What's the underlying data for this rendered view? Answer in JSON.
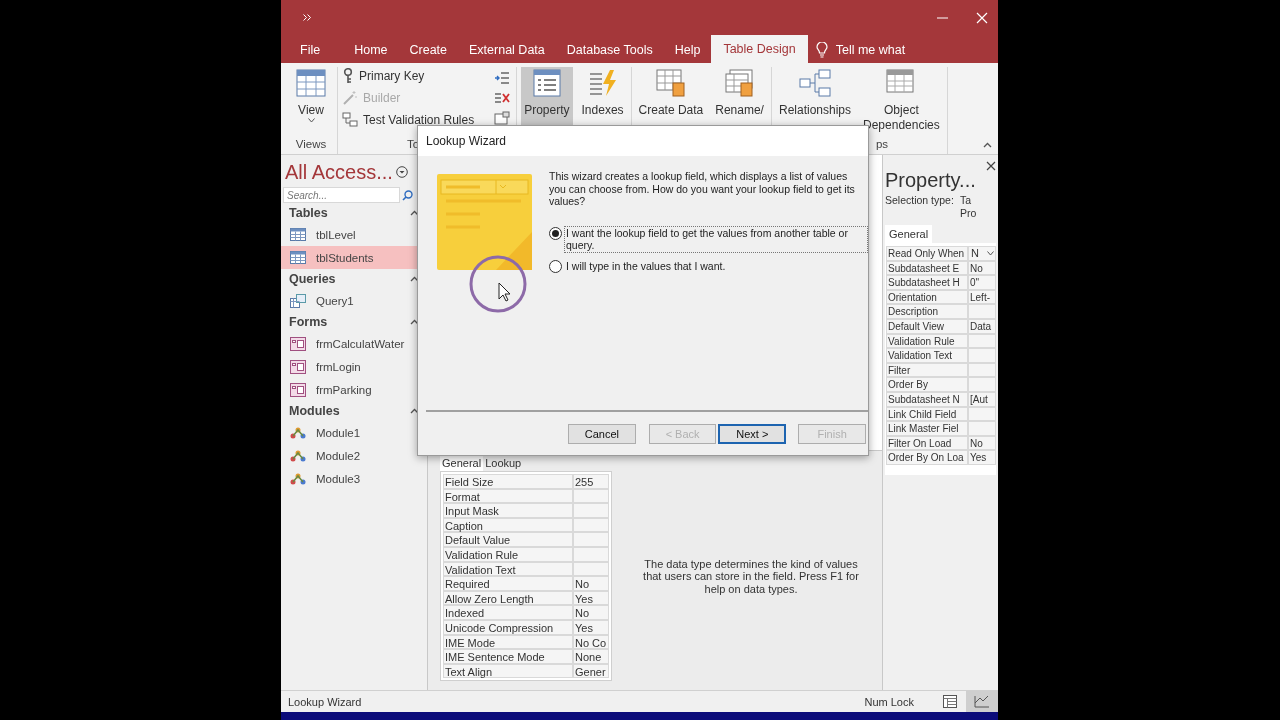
{
  "tabs": [
    {
      "label": "File",
      "selected": false
    },
    {
      "label": "Home",
      "selected": false
    },
    {
      "label": "Create",
      "selected": false
    },
    {
      "label": "External Data",
      "selected": false
    },
    {
      "label": "Database Tools",
      "selected": false
    },
    {
      "label": "Help",
      "selected": false
    },
    {
      "label": "Table Design",
      "selected": true
    }
  ],
  "tell_me": "Tell me what",
  "ribbon": [
    {
      "label": "Views",
      "items": [
        {
          "kind": "large",
          "lines": [
            "View"
          ],
          "dropdown": true,
          "pressed": false
        }
      ]
    },
    {
      "label": "To",
      "items": [
        {
          "kind": "small",
          "label": "Primary Key",
          "disabled": false
        },
        {
          "kind": "small",
          "label": "Builder",
          "disabled": true
        },
        {
          "kind": "small",
          "label": "Test Validation Rules",
          "disabled": false
        },
        {
          "kind": "icons"
        }
      ]
    },
    {
      "items": [
        {
          "kind": "large",
          "lines": [
            "Property"
          ],
          "dropdown": false,
          "pressed": true
        },
        {
          "kind": "large",
          "lines": [
            "Indexes"
          ],
          "dropdown": false,
          "pressed": false
        }
      ]
    },
    {
      "items": [
        {
          "kind": "large",
          "lines": [
            "Create Data"
          ],
          "dropdown": false,
          "pressed": false
        },
        {
          "kind": "large",
          "lines": [
            "Rename/"
          ],
          "dropdown": false,
          "pressed": false
        }
      ]
    },
    {
      "label": "ps",
      "items": [
        {
          "kind": "large",
          "lines": [
            "Relationships"
          ],
          "dropdown": false,
          "pressed": false
        },
        {
          "kind": "large",
          "lines": [
            "Object",
            "Dependencies"
          ],
          "dropdown": false,
          "pressed": false
        }
      ]
    }
  ],
  "nav": {
    "title": "All Access...",
    "search_placeholder": "Search...",
    "groups": [
      {
        "label": "Tables",
        "kind": "table",
        "expanded": true,
        "items": [
          {
            "label": "tblLevel",
            "selected": false
          },
          {
            "label": "tblStudents",
            "selected": true
          }
        ]
      },
      {
        "label": "Queries",
        "kind": "query",
        "expanded": true,
        "items": [
          {
            "label": "Query1",
            "selected": false
          }
        ]
      },
      {
        "label": "Forms",
        "kind": "form",
        "expanded": true,
        "items": [
          {
            "label": "frmCalculatWater",
            "selected": false
          },
          {
            "label": "frmLogin",
            "selected": false
          },
          {
            "label": "frmParking",
            "selected": false
          }
        ]
      },
      {
        "label": "Modules",
        "kind": "module",
        "expanded": true,
        "items": [
          {
            "label": "Module1",
            "selected": false
          },
          {
            "label": "Module2",
            "selected": false
          },
          {
            "label": "Module3",
            "selected": false
          }
        ]
      }
    ]
  },
  "dialog": {
    "title": "Lookup Wizard",
    "intro": "This wizard creates a lookup field, which displays a list of values you can choose from.  How do you want your lookup field to get its values?",
    "options": [
      {
        "label": "I want the lookup field to get the values from another table or query.",
        "selected": true
      },
      {
        "label": "I will type in the values that I want.",
        "selected": false
      }
    ],
    "buttons": [
      {
        "label": "Cancel",
        "disabled": false,
        "default": false
      },
      {
        "label": "< Back",
        "disabled": true,
        "default": false
      },
      {
        "label": "Next >",
        "disabled": false,
        "default": true
      },
      {
        "label": "Finish",
        "disabled": true,
        "default": false
      }
    ]
  },
  "field_properties": {
    "tabs": [
      {
        "label": "General",
        "selected": true
      },
      {
        "label": "Lookup",
        "selected": false
      }
    ],
    "rows": [
      {
        "name": "Field Size",
        "value": "255"
      },
      {
        "name": "Format"
      },
      {
        "name": "Input Mask"
      },
      {
        "name": "Caption"
      },
      {
        "name": "Default Value"
      },
      {
        "name": "Validation Rule"
      },
      {
        "name": "Validation Text"
      },
      {
        "name": "Required",
        "value": "No"
      },
      {
        "name": "Allow Zero Length",
        "value": "Yes"
      },
      {
        "name": "Indexed",
        "value": "No"
      },
      {
        "name": "Unicode Compression",
        "value": "Yes"
      },
      {
        "name": "IME Mode",
        "value": "No Co"
      },
      {
        "name": "IME Sentence Mode",
        "value": "None"
      },
      {
        "name": "Text Align",
        "value": "Gener"
      }
    ],
    "help": "The data type determines the kind of values that users can store in the field. Press F1 for help on data types."
  },
  "property_sheet": {
    "title": "Property...",
    "selection_label": "Selection type:",
    "selection_value": [
      "Ta",
      "Pro"
    ],
    "tabs": [
      {
        "label": "General",
        "selected": true
      }
    ],
    "rows": [
      {
        "name": "Read Only When",
        "value": "N",
        "dropdown": true
      },
      {
        "name": "Subdatasheet E",
        "value": "No",
        "dropdown": false
      },
      {
        "name": "Subdatasheet H",
        "value": "0\"",
        "dropdown": false
      },
      {
        "name": "Orientation",
        "value": "Left-",
        "dropdown": false
      },
      {
        "name": "Description",
        "dropdown": false
      },
      {
        "name": "Default View",
        "value": "Data",
        "dropdown": false
      },
      {
        "name": "Validation Rule",
        "dropdown": false
      },
      {
        "name": "Validation Text",
        "dropdown": false
      },
      {
        "name": "Filter",
        "dropdown": false
      },
      {
        "name": "Order By",
        "dropdown": false
      },
      {
        "name": "Subdatasheet N",
        "value": "[Aut",
        "dropdown": false
      },
      {
        "name": "Link Child Field",
        "dropdown": false
      },
      {
        "name": "Link Master Fiel",
        "dropdown": false
      },
      {
        "name": "Filter On Load",
        "value": "No",
        "dropdown": false
      },
      {
        "name": "Order By On Loa",
        "value": "Yes",
        "dropdown": false
      }
    ]
  },
  "status_bar": {
    "text": "Lookup Wizard",
    "num_lock": "Num Lock",
    "views": [
      {
        "selected": false
      },
      {
        "selected": true
      }
    ]
  }
}
